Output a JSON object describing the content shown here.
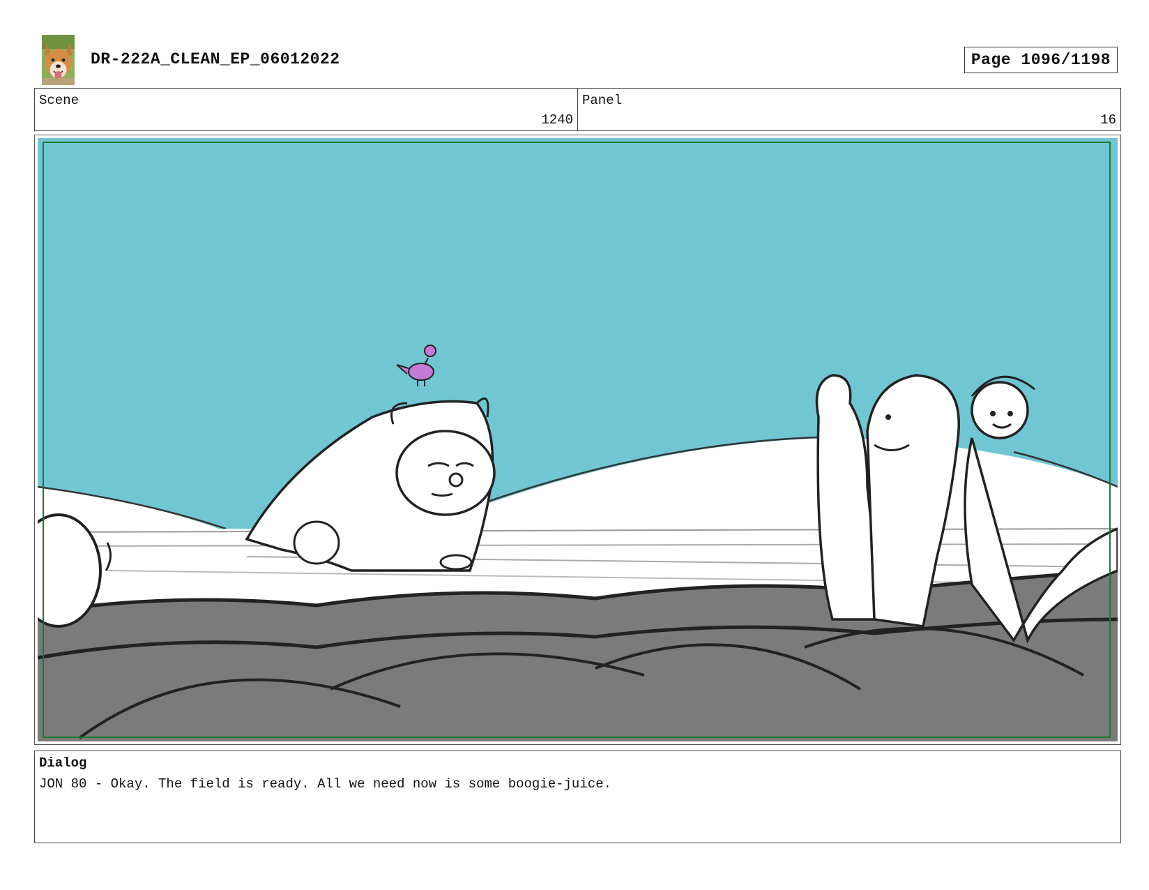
{
  "header": {
    "title": "DR-222A_CLEAN_EP_06012022",
    "page": "Page 1096/1198",
    "logo_icon": "dog-avatar-icon"
  },
  "info": {
    "scene_label": "Scene",
    "scene_value": "1240",
    "panel_label": "Panel",
    "panel_value": "16"
  },
  "panel_image": {
    "description_icon": "storyboard-drawing",
    "sky_color": "#70c6d3",
    "ground_color": "#7b7b7b",
    "safe_frame_color": "#1d7a2c",
    "bird_color": "#c67ad8"
  },
  "dialog": {
    "label": "Dialog",
    "text": "JON 80 - Okay. The field is ready. All we need now is some boogie-juice."
  }
}
